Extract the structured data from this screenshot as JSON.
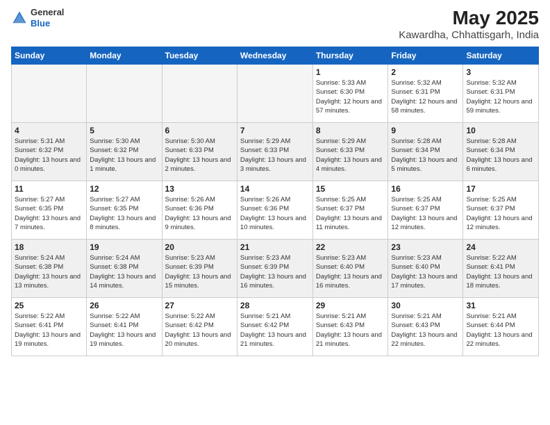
{
  "header": {
    "logo_general": "General",
    "logo_blue": "Blue",
    "title": "May 2025",
    "subtitle": "Kawardha, Chhattisgarh, India"
  },
  "calendar": {
    "days_of_week": [
      "Sunday",
      "Monday",
      "Tuesday",
      "Wednesday",
      "Thursday",
      "Friday",
      "Saturday"
    ],
    "weeks": [
      [
        {
          "day": "",
          "info": "",
          "empty": true
        },
        {
          "day": "",
          "info": "",
          "empty": true
        },
        {
          "day": "",
          "info": "",
          "empty": true
        },
        {
          "day": "",
          "info": "",
          "empty": true
        },
        {
          "day": "1",
          "info": "Sunrise: 5:33 AM\nSunset: 6:30 PM\nDaylight: 12 hours\nand 57 minutes."
        },
        {
          "day": "2",
          "info": "Sunrise: 5:32 AM\nSunset: 6:31 PM\nDaylight: 12 hours\nand 58 minutes."
        },
        {
          "day": "3",
          "info": "Sunrise: 5:32 AM\nSunset: 6:31 PM\nDaylight: 12 hours\nand 59 minutes."
        }
      ],
      [
        {
          "day": "4",
          "info": "Sunrise: 5:31 AM\nSunset: 6:32 PM\nDaylight: 13 hours\nand 0 minutes."
        },
        {
          "day": "5",
          "info": "Sunrise: 5:30 AM\nSunset: 6:32 PM\nDaylight: 13 hours\nand 1 minute."
        },
        {
          "day": "6",
          "info": "Sunrise: 5:30 AM\nSunset: 6:33 PM\nDaylight: 13 hours\nand 2 minutes."
        },
        {
          "day": "7",
          "info": "Sunrise: 5:29 AM\nSunset: 6:33 PM\nDaylight: 13 hours\nand 3 minutes."
        },
        {
          "day": "8",
          "info": "Sunrise: 5:29 AM\nSunset: 6:33 PM\nDaylight: 13 hours\nand 4 minutes."
        },
        {
          "day": "9",
          "info": "Sunrise: 5:28 AM\nSunset: 6:34 PM\nDaylight: 13 hours\nand 5 minutes."
        },
        {
          "day": "10",
          "info": "Sunrise: 5:28 AM\nSunset: 6:34 PM\nDaylight: 13 hours\nand 6 minutes."
        }
      ],
      [
        {
          "day": "11",
          "info": "Sunrise: 5:27 AM\nSunset: 6:35 PM\nDaylight: 13 hours\nand 7 minutes."
        },
        {
          "day": "12",
          "info": "Sunrise: 5:27 AM\nSunset: 6:35 PM\nDaylight: 13 hours\nand 8 minutes."
        },
        {
          "day": "13",
          "info": "Sunrise: 5:26 AM\nSunset: 6:36 PM\nDaylight: 13 hours\nand 9 minutes."
        },
        {
          "day": "14",
          "info": "Sunrise: 5:26 AM\nSunset: 6:36 PM\nDaylight: 13 hours\nand 10 minutes."
        },
        {
          "day": "15",
          "info": "Sunrise: 5:25 AM\nSunset: 6:37 PM\nDaylight: 13 hours\nand 11 minutes."
        },
        {
          "day": "16",
          "info": "Sunrise: 5:25 AM\nSunset: 6:37 PM\nDaylight: 13 hours\nand 12 minutes."
        },
        {
          "day": "17",
          "info": "Sunrise: 5:25 AM\nSunset: 6:37 PM\nDaylight: 13 hours\nand 12 minutes."
        }
      ],
      [
        {
          "day": "18",
          "info": "Sunrise: 5:24 AM\nSunset: 6:38 PM\nDaylight: 13 hours\nand 13 minutes."
        },
        {
          "day": "19",
          "info": "Sunrise: 5:24 AM\nSunset: 6:38 PM\nDaylight: 13 hours\nand 14 minutes."
        },
        {
          "day": "20",
          "info": "Sunrise: 5:23 AM\nSunset: 6:39 PM\nDaylight: 13 hours\nand 15 minutes."
        },
        {
          "day": "21",
          "info": "Sunrise: 5:23 AM\nSunset: 6:39 PM\nDaylight: 13 hours\nand 16 minutes."
        },
        {
          "day": "22",
          "info": "Sunrise: 5:23 AM\nSunset: 6:40 PM\nDaylight: 13 hours\nand 16 minutes."
        },
        {
          "day": "23",
          "info": "Sunrise: 5:23 AM\nSunset: 6:40 PM\nDaylight: 13 hours\nand 17 minutes."
        },
        {
          "day": "24",
          "info": "Sunrise: 5:22 AM\nSunset: 6:41 PM\nDaylight: 13 hours\nand 18 minutes."
        }
      ],
      [
        {
          "day": "25",
          "info": "Sunrise: 5:22 AM\nSunset: 6:41 PM\nDaylight: 13 hours\nand 19 minutes."
        },
        {
          "day": "26",
          "info": "Sunrise: 5:22 AM\nSunset: 6:41 PM\nDaylight: 13 hours\nand 19 minutes."
        },
        {
          "day": "27",
          "info": "Sunrise: 5:22 AM\nSunset: 6:42 PM\nDaylight: 13 hours\nand 20 minutes."
        },
        {
          "day": "28",
          "info": "Sunrise: 5:21 AM\nSunset: 6:42 PM\nDaylight: 13 hours\nand 21 minutes."
        },
        {
          "day": "29",
          "info": "Sunrise: 5:21 AM\nSunset: 6:43 PM\nDaylight: 13 hours\nand 21 minutes."
        },
        {
          "day": "30",
          "info": "Sunrise: 5:21 AM\nSunset: 6:43 PM\nDaylight: 13 hours\nand 22 minutes."
        },
        {
          "day": "31",
          "info": "Sunrise: 5:21 AM\nSunset: 6:44 PM\nDaylight: 13 hours\nand 22 minutes."
        }
      ]
    ]
  }
}
